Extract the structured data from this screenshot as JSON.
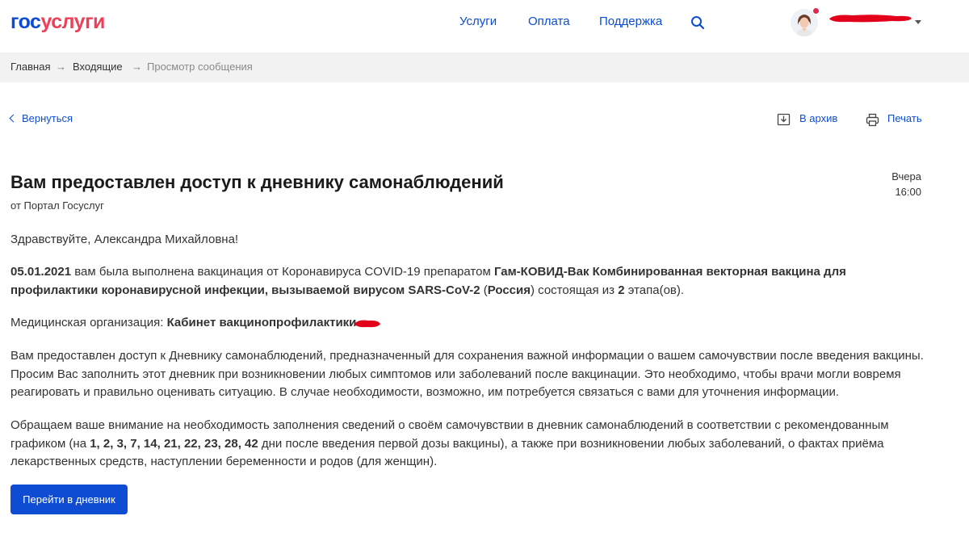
{
  "header": {
    "logo_part1": "гос",
    "logo_part2": "услуги",
    "nav": [
      "Услуги",
      "Оплата",
      "Поддержка"
    ],
    "search_icon": "search-icon",
    "avatar_icon": "user-avatar-icon"
  },
  "breadcrumb": {
    "items": [
      "Главная",
      "Входящие",
      "Просмотр сообщения"
    ]
  },
  "actions": {
    "back": "Вернуться",
    "archive": "В архив",
    "print": "Печать"
  },
  "message": {
    "title": "Вам предоставлен доступ к дневнику самонаблюдений",
    "sender": "от Портал Госуслуг",
    "date_day": "Вчера",
    "date_time": "16:00",
    "greeting": "Здравствуйте, Александра Михайловна!",
    "vaccination": {
      "date": "05.01.2021",
      "text1": " вам была выполнена вакцинация от Коронавируса COVID-19 препаратом ",
      "vaccine": "Гам-КОВИД-Вак Комбинированная векторная вакцина для профилактики коронавирусной инфекции, вызываемой вирусом SARS-CoV-2",
      "text2": " (",
      "country": "Россия",
      "text3": ") состоящая из ",
      "stages": "2",
      "text4": " этапа(ов)."
    },
    "org_label": "Медицинская организация: ",
    "org_name": "Кабинет вакцинопрофилактики",
    "access_paragraph": "Вам предоставлен доступ к Дневнику самонаблюдений, предназначенный для сохранения важной информации о вашем самочувствии после введения вакцины. Просим Вас заполнить этот дневник при возникновении любых симптомов или заболеваний после вакцинации. Это необходимо, чтобы врачи могли вовремя реагировать и правильно оценивать ситуацию. В случае необходимости, возможно, им потребуется связаться с вами для уточнения информации.",
    "schedule": {
      "text1": "Обращаем ваше внимание на необходимость заполнения сведений о своём самочувствии в дневник самонаблюдений в соответствии с рекомендованным графиком (на ",
      "days": "1, 2, 3, 7, 14, 21, 22, 23, 28, 42",
      "text2": " дни после введения первой дозы вакцины), а также при возникновении любых заболеваний, о фактах приёма лекарственных средств, наступлении беременности и родов (для женщин)."
    },
    "cta": "Перейти в дневник"
  },
  "colors": {
    "brand_blue": "#0d4cd3",
    "brand_red": "#ee3f58",
    "redaction": "#e3001b"
  }
}
